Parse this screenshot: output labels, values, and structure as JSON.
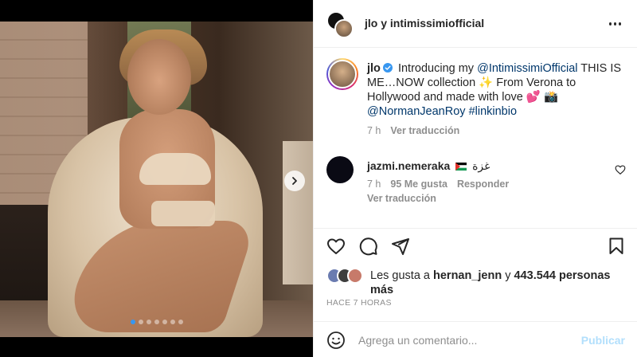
{
  "header": {
    "title": "jlo y intimissimiofficial",
    "more_icon": "more-horizontal-icon"
  },
  "caption": {
    "username": "jlo",
    "text_1": " Introducing my ",
    "mention_1": "@IntimissimiOfficial",
    "text_2": " THIS IS ME…NOW collection ✨ From Verona to Hollywood and made with love 💕 📸 ",
    "mention_2": "@NormanJeanRoy",
    "text_3": " ",
    "hashtag": "#linkinbio",
    "time": "7 h",
    "translate": "Ver traducción"
  },
  "comment": {
    "username": "jazmi.nemeraka",
    "text": "غزة",
    "time": "7 h",
    "likes": "95 Me gusta",
    "reply": "Responder",
    "translate": "Ver traducción"
  },
  "likes": {
    "prefix": "Les gusta a ",
    "user": "hernan_jenn",
    "middle": " y ",
    "count": "443.544 personas más"
  },
  "time_ago": "HACE 7 HORAS",
  "add_comment": {
    "placeholder": "Agrega un comentario...",
    "publish": "Publicar"
  },
  "carousel": {
    "total_dots": 7,
    "active_index": 0
  },
  "colors": {
    "link": "#00376b",
    "muted": "#8e8e8e",
    "publish_disabled": "#b2dffc",
    "active_dot": "#3897f0"
  }
}
